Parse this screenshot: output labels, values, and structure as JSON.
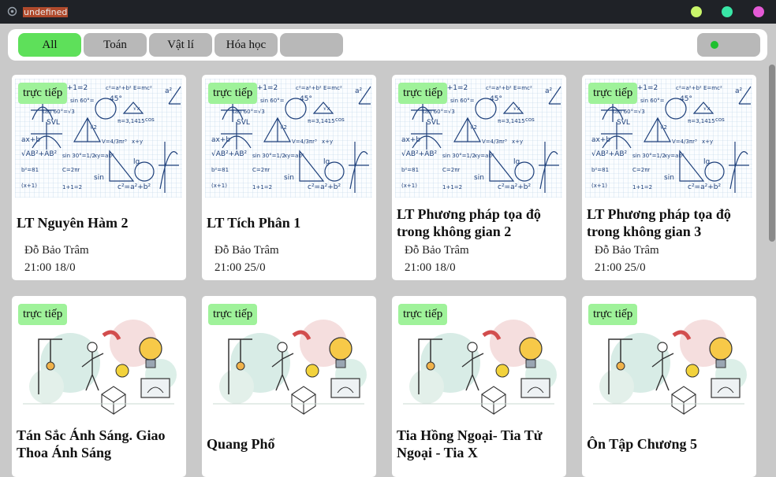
{
  "window": {
    "title": "undefined",
    "controls": [
      {
        "name": "minimize-button",
        "color": "#c9f56a"
      },
      {
        "name": "maximize-button",
        "color": "#39e6a6"
      },
      {
        "name": "close-button",
        "color": "#e45ad6"
      }
    ]
  },
  "filters": {
    "chips": [
      {
        "label": "All",
        "active": true
      },
      {
        "label": "Toán",
        "active": false
      },
      {
        "label": "Vật lí",
        "active": false
      },
      {
        "label": "Hóa học",
        "active": false
      },
      {
        "label": "",
        "active": false
      }
    ]
  },
  "cards": [
    {
      "badge": "trực tiếp",
      "title": "LT Nguyên Hàm 2",
      "teacher": "Đỗ Bảo Trâm",
      "time": "21:00 18/0",
      "image": "math-formulas"
    },
    {
      "badge": "trực tiếp",
      "title": "LT Tích Phân 1",
      "teacher": "Đỗ Bảo Trâm",
      "time": "21:00 25/0",
      "image": "math-formulas"
    },
    {
      "badge": "trực tiếp",
      "title": "LT Phương pháp tọa độ trong không gian 2",
      "teacher": "Đỗ Bảo Trâm",
      "time": "21:00 18/0",
      "image": "math-formulas"
    },
    {
      "badge": "trực tiếp",
      "title": "LT Phương pháp tọa độ trong không gian 3",
      "teacher": "Đỗ Bảo Trâm",
      "time": "21:00 25/0",
      "image": "math-formulas"
    },
    {
      "badge": "trực tiếp",
      "title": "Tán Sắc Ánh Sáng. Giao Thoa Ánh Sáng",
      "image": "physics-lab"
    },
    {
      "badge": "trực tiếp",
      "title": "Quang Phổ",
      "image": "physics-lab"
    },
    {
      "badge": "trực tiếp",
      "title": "Tia Hồng Ngoại- Tia Tử Ngoại - Tia X",
      "image": "physics-lab"
    },
    {
      "badge": "trực tiếp",
      "title": "Ôn Tập Chương 5",
      "image": "physics-lab"
    }
  ],
  "math_art": {
    "formulas": [
      "1+1=2",
      "c²=a²+b²",
      "E=mc²",
      "a²",
      "sin 60°=",
      "tan 60°=√3",
      "45°",
      "√x",
      "cos",
      "SVL",
      "π=3,1415",
      "√2",
      "ax+b",
      "V=4/3πr³",
      "x+y",
      "√AB²+AB²",
      "sin 30°=1/2",
      "xy=ab²",
      "lg",
      "b²=81",
      "C=2πr",
      "sin",
      "(x+1)"
    ]
  },
  "colors": {
    "accent": "#5ee05a",
    "badge": "#9ff29a",
    "chip": "#b8b8b8",
    "status": "#1fc02f"
  }
}
